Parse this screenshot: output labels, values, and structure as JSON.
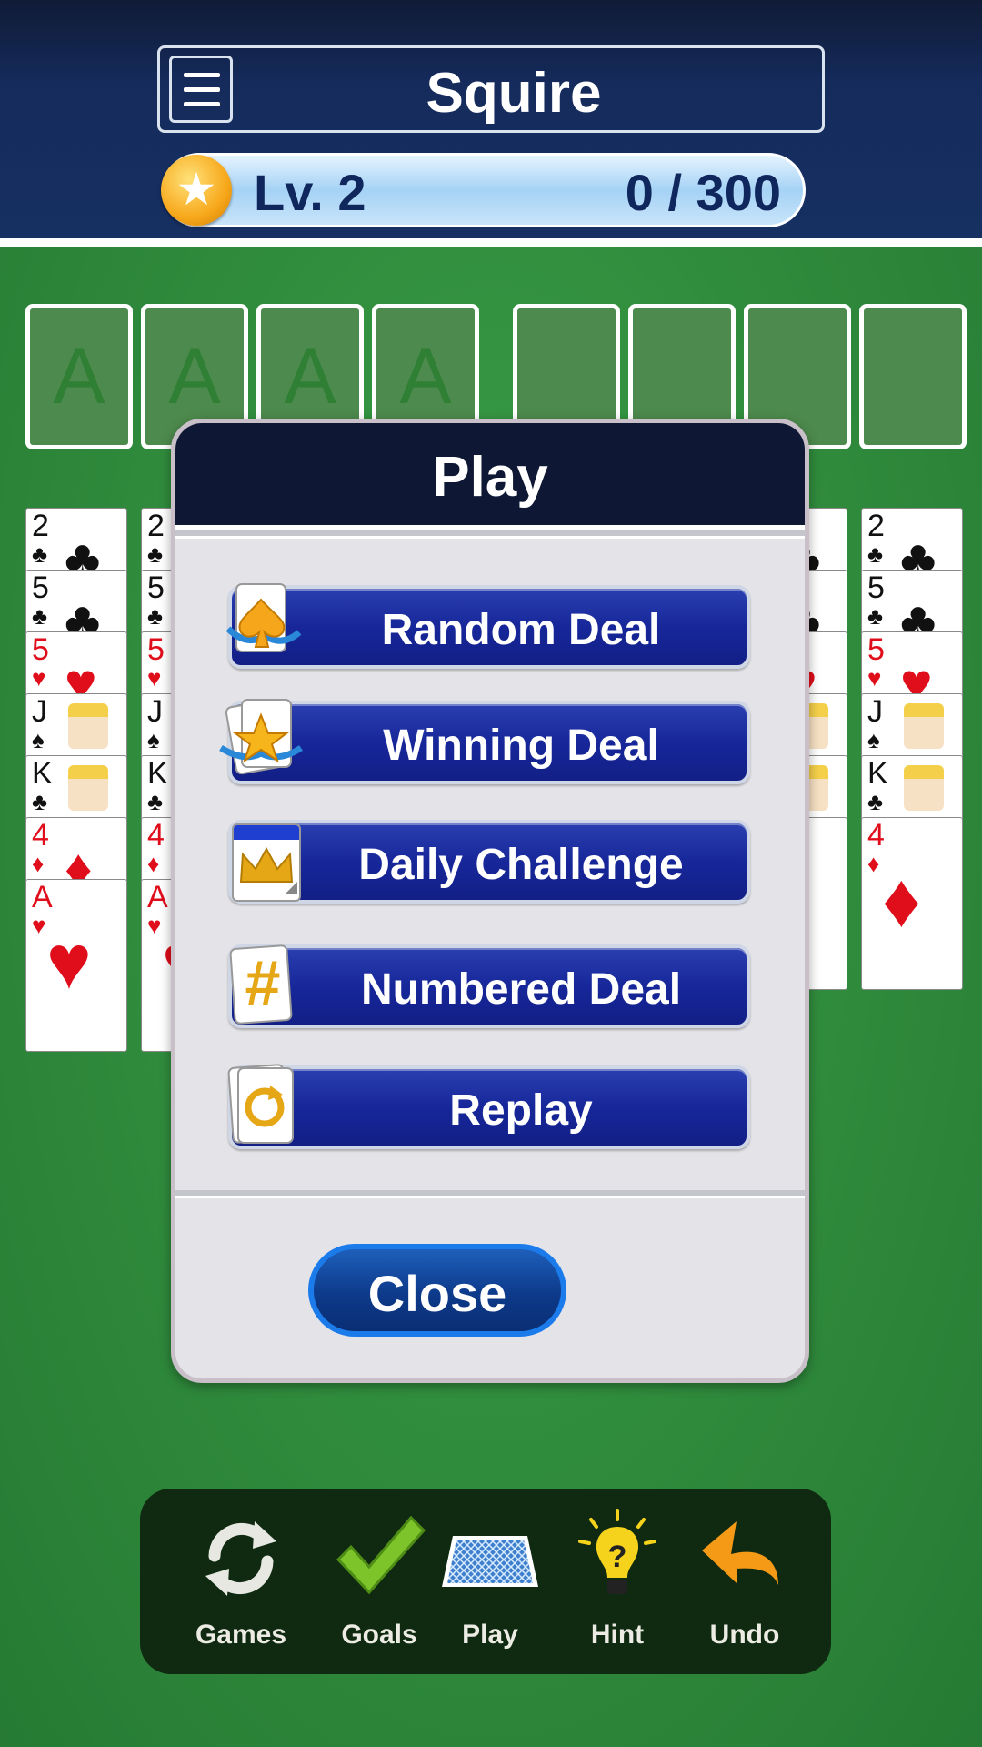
{
  "header": {
    "title": "Squire",
    "level_label": "Lv. 2",
    "xp_label": "0 / 300",
    "progress_fraction": 0.0
  },
  "foundations": {
    "ace_labels": [
      "A",
      "A",
      "A",
      "A"
    ],
    "empty_slots": 4
  },
  "tableau": {
    "visible_columns": [
      {
        "cards": [
          "2♣",
          "5♣",
          "5♥",
          "J♠",
          "K♣",
          "4♦",
          "A♥"
        ]
      },
      {
        "cards": [
          "2♣",
          "5♣",
          "5♥",
          "J♠",
          "K♣",
          "4♦",
          "A♥"
        ]
      },
      {
        "cards": [
          "2♣",
          "5♣",
          "5♥",
          "J♠",
          "K♣",
          "4♦"
        ]
      },
      {
        "cards": [
          "2♣",
          "5♣",
          "5♥",
          "J♠",
          "K♣",
          "4♦"
        ]
      }
    ]
  },
  "modal": {
    "title": "Play",
    "buttons": [
      {
        "label": "Random Deal",
        "icon": "spade-card-icon"
      },
      {
        "label": "Winning Deal",
        "icon": "star-card-icon"
      },
      {
        "label": "Daily Challenge",
        "icon": "calendar-crown-icon"
      },
      {
        "label": "Numbered Deal",
        "icon": "hash-card-icon"
      },
      {
        "label": "Replay",
        "icon": "replay-card-icon"
      }
    ],
    "close_label": "Close"
  },
  "toolbar": {
    "items": [
      {
        "label": "Games",
        "icon": "refresh-icon"
      },
      {
        "label": "Goals",
        "icon": "checkmark-icon"
      },
      {
        "label": "Play",
        "icon": "card-deck-icon"
      },
      {
        "label": "Hint",
        "icon": "lightbulb-icon"
      },
      {
        "label": "Undo",
        "icon": "undo-arrow-icon"
      }
    ]
  },
  "colors": {
    "felt": "#2f8a3c",
    "header": "#152b5c",
    "button_blue": "#17279a",
    "hint_yellow": "#f5d21c",
    "undo_orange": "#f59a16",
    "goals_green": "#7cc42a"
  }
}
